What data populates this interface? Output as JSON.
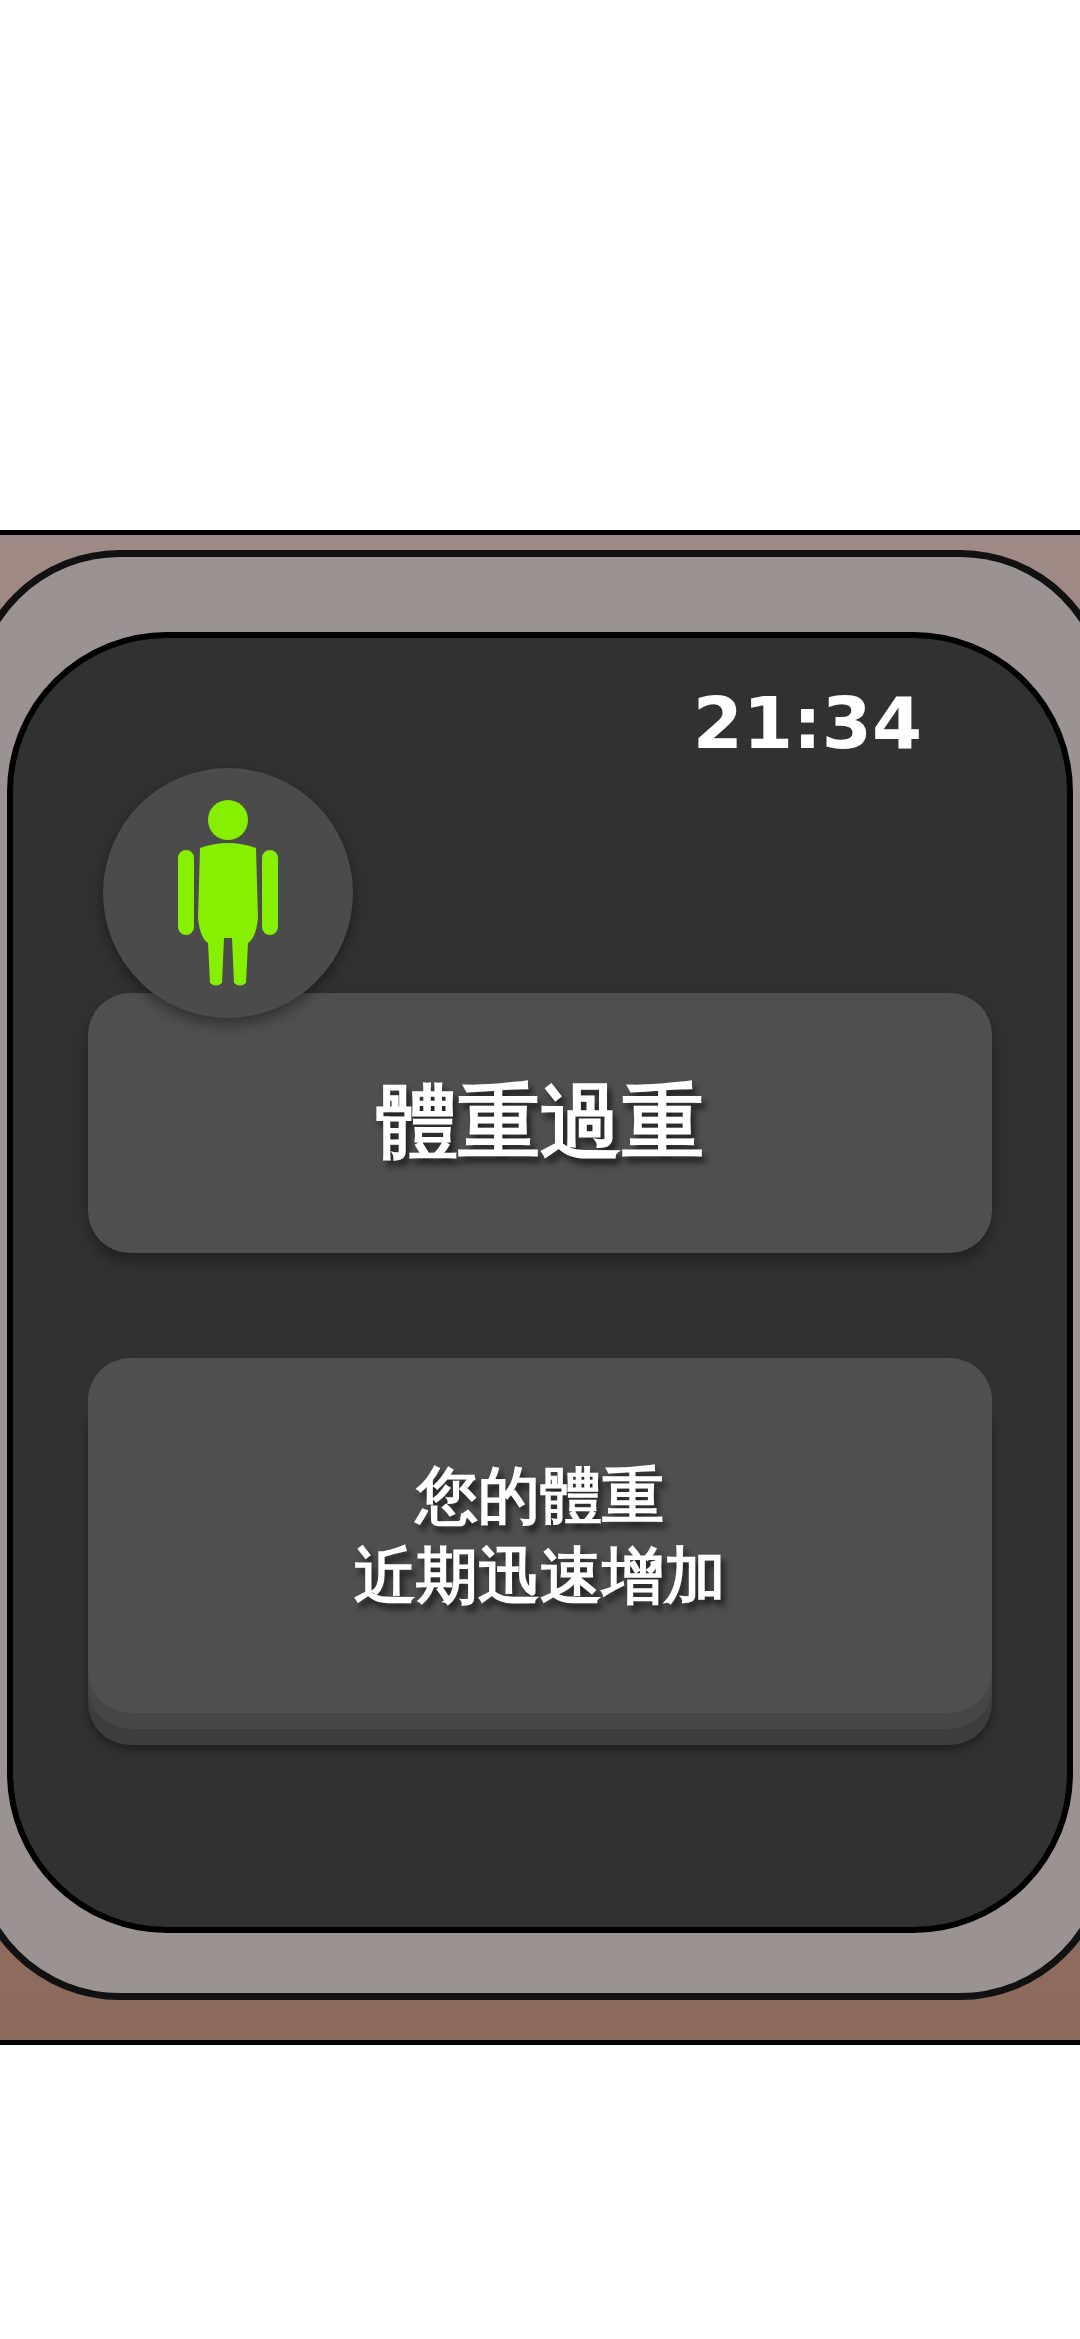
{
  "watch": {
    "time": "21:34",
    "alert": {
      "title": "體重過重"
    },
    "message": {
      "lines": [
        "您的體重",
        "近期迅速增加"
      ]
    }
  }
}
